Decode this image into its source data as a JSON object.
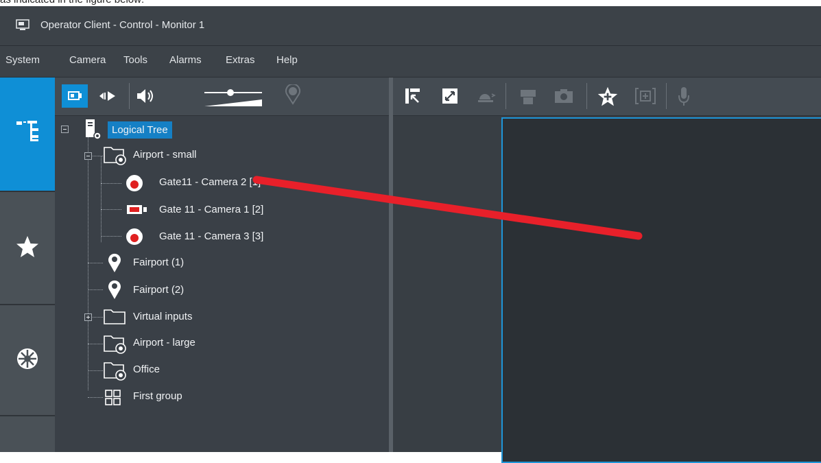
{
  "caption": "as indicated in the figure below:",
  "window": {
    "title": "Operator Client - Control - Monitor 1"
  },
  "menu": [
    "System",
    "Camera",
    "Tools",
    "Alarms",
    "Extras",
    "Help"
  ],
  "left_tabs": [
    {
      "icon": "logical-tree-icon",
      "active": true
    },
    {
      "icon": "star-icon",
      "active": false
    },
    {
      "icon": "alarm-wheel-icon",
      "active": false
    },
    {
      "icon": "blank-tab",
      "active": false
    }
  ],
  "tree": {
    "root": "Logical Tree",
    "items": [
      {
        "label": "Airport - small",
        "icon": "site-folder-icon"
      },
      {
        "label": "Gate11 - Camera 2 [1]",
        "icon": "ptz-camera-icon"
      },
      {
        "label": "Gate 11 - Camera 1 [2]",
        "icon": "box-camera-icon"
      },
      {
        "label": "Gate 11 - Camera 3 [3]",
        "icon": "ptz-camera-icon"
      },
      {
        "label": "Fairport (1)",
        "icon": "map-pin-icon"
      },
      {
        "label": "Fairport (2)",
        "icon": "map-pin-icon"
      },
      {
        "label": "Virtual inputs",
        "icon": "folder-icon"
      },
      {
        "label": "Airport - large",
        "icon": "site-folder-icon"
      },
      {
        "label": "Office",
        "icon": "site-folder-icon"
      },
      {
        "label": "First group",
        "icon": "group-grid-icon"
      }
    ]
  },
  "colors": {
    "accent": "#1e95d8",
    "selection": "#1580c5",
    "annotation": "#e8202a"
  }
}
